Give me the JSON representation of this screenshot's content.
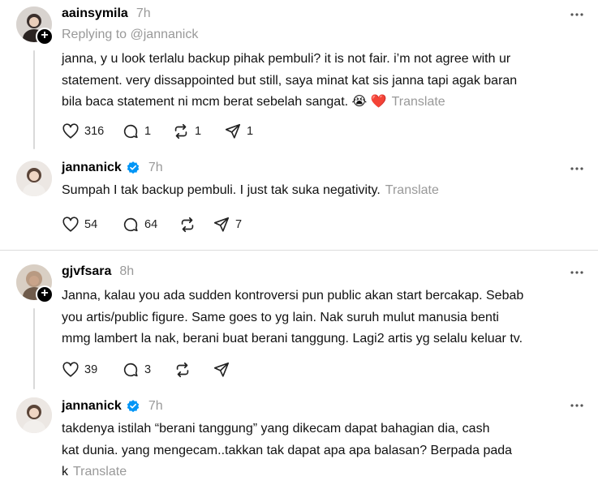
{
  "posts": [
    {
      "username": "aainsymila",
      "time": "7h",
      "replying_to": "Replying to @jannanick",
      "text_lines": [
        "janna, y u look terlalu backup pihak pembuli? it is not fair. i’m not agree with ur",
        "statement. very dissappointed but still, saya minat kat sis janna tapi agak baran",
        "bila baca statement ni mcm berat sebelah sangat. 😭 ❤️"
      ],
      "translate": "Translate",
      "likes": "316",
      "replies": "1",
      "reposts": "1",
      "shares": "1"
    },
    {
      "username": "jannanick",
      "time": "7h",
      "text_lines": [
        "Sumpah I tak backup pembuli. I just tak suka negativity."
      ],
      "translate": "Translate",
      "likes": "54",
      "replies": "64",
      "reposts": "",
      "shares": "7"
    },
    {
      "username": "gjvfsara",
      "time": "8h",
      "text_lines": [
        "Janna, kalau you ada sudden kontroversi pun public akan start bercakap. Sebab",
        "you artis/public figure. Same goes to yg lain. Nak suruh mulut manusia benti",
        "mmg lambert la nak, berani buat berani tanggung. Lagi2 artis yg selalu keluar tv."
      ],
      "likes": "39",
      "replies": "3",
      "reposts": "",
      "shares": ""
    },
    {
      "username": "jannanick",
      "time": "7h",
      "text_lines": [
        "takdenya istilah “berani tanggung” yang dikecam dapat bahagian dia, cash",
        "kat dunia. yang mengecam..takkan tak dapat apa apa balasan? Berpada pada",
        "k"
      ],
      "translate": "Translate"
    }
  ],
  "icons": {
    "like": "heart-icon",
    "reply": "comment-icon",
    "repost": "repost-icon",
    "share": "send-icon",
    "more": "more-options-icon",
    "verified": "verified-badge-icon",
    "follow": "plus-icon"
  },
  "colors": {
    "verified": "#0095f6",
    "muted": "#999999",
    "divider": "#dcdcdc"
  }
}
